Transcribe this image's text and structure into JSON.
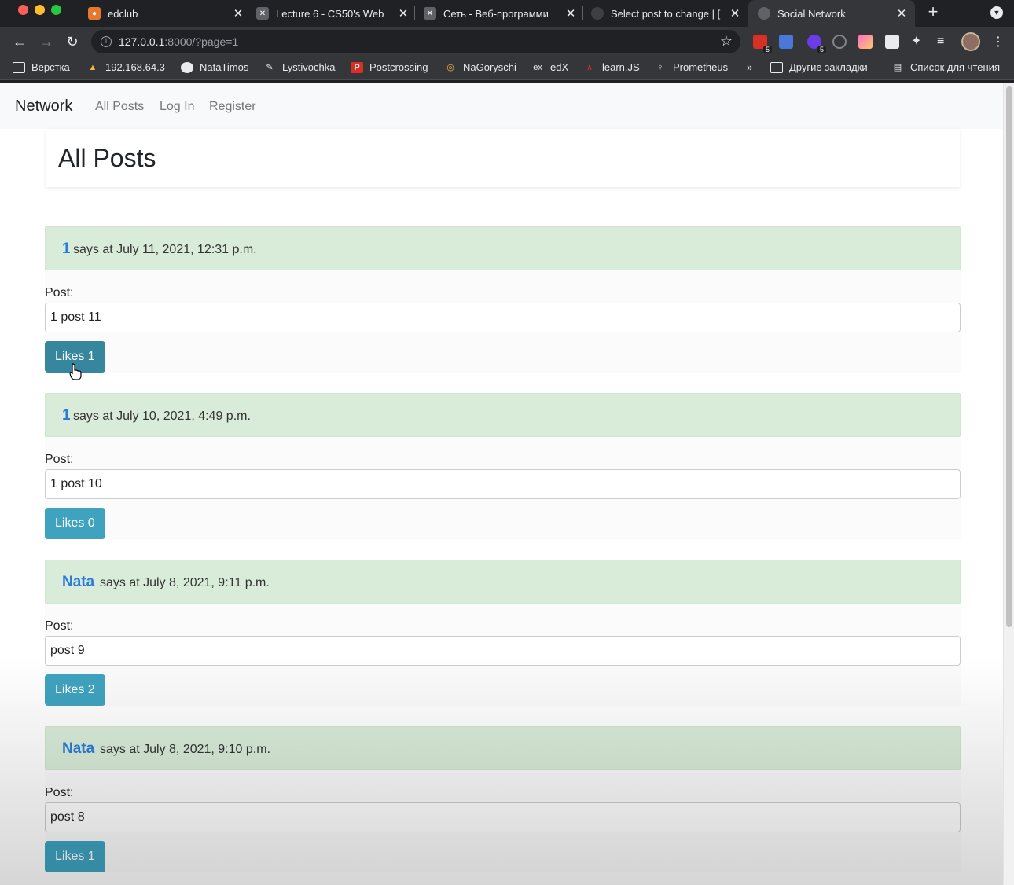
{
  "browser": {
    "tabs": [
      {
        "title": "edclub",
        "active": false
      },
      {
        "title": "Lecture 6 - CS50's Web",
        "active": false
      },
      {
        "title": "Сеть - Веб-программи",
        "active": false
      },
      {
        "title": "Select post to change | [",
        "active": false
      },
      {
        "title": "Social Network",
        "active": true
      }
    ],
    "url_host": "127.0.0.1",
    "url_rest": ":8000/?page=1",
    "extension_badges": [
      "5",
      "5"
    ],
    "bookmarks": [
      {
        "label": "Верстка",
        "icon": "folder-icon"
      },
      {
        "label": "192.168.64.3",
        "icon": "server-icon"
      },
      {
        "label": "NataTimos",
        "icon": "github-icon"
      },
      {
        "label": "Lystivochka",
        "icon": "bookmark-icon"
      },
      {
        "label": "Postcrossing",
        "icon": "postcrossing-icon"
      },
      {
        "label": "NaGoryschi",
        "icon": "bookmark-icon"
      },
      {
        "label": "edX",
        "icon": "edx-icon"
      },
      {
        "label": "learn.JS",
        "icon": "learnjs-icon"
      },
      {
        "label": "Prometheus",
        "icon": "prometheus-icon"
      }
    ],
    "overflow_label": "»",
    "other_bookmarks": "Другие закладки",
    "reading_list": "Список для чтения"
  },
  "navbar": {
    "brand": "Network",
    "links": [
      "All Posts",
      "Log In",
      "Register"
    ]
  },
  "page_title": "All Posts",
  "posts": [
    {
      "author": "1",
      "meta": "says at July 11, 2021, 12:31 p.m.",
      "label": "Post:",
      "content": "1 post 11",
      "likes": "Likes 1"
    },
    {
      "author": "1",
      "meta": "says at July 10, 2021, 4:49 p.m.",
      "label": "Post:",
      "content": "1 post 10",
      "likes": "Likes 0"
    },
    {
      "author": "Nata",
      "meta": "says at July 8, 2021, 9:11 p.m.",
      "label": "Post:",
      "content": "post 9",
      "likes": "Likes 2"
    },
    {
      "author": "Nata",
      "meta": "says at July 8, 2021, 9:10 p.m.",
      "label": "Post:",
      "content": "post 8",
      "likes": "Likes 1"
    }
  ],
  "colors": {
    "post_header": "#d9ecd9",
    "author_link": "#2b7bdb",
    "likes_button": "#3fa3c0"
  }
}
